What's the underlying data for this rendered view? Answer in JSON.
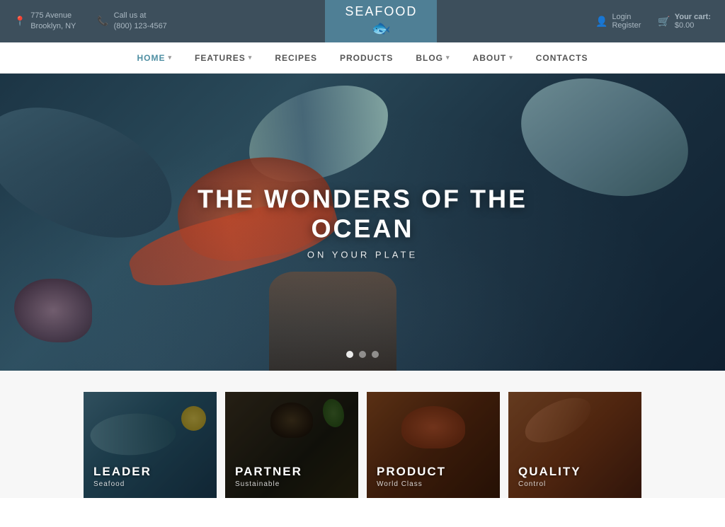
{
  "topbar": {
    "address_icon": "📍",
    "address_line1": "775 Avenue",
    "address_line2": "Brooklyn, NY",
    "phone_icon": "📞",
    "phone_label": "Call us at",
    "phone_number": "(800) 123-4567",
    "logo_part1": "SEA",
    "logo_part2": "FOOD",
    "login_icon": "👤",
    "login_label": "Login",
    "register_label": "Register",
    "cart_icon": "🛒",
    "cart_label": "Your cart:",
    "cart_amount": "$0.00"
  },
  "nav": {
    "items": [
      {
        "label": "HOME",
        "active": true,
        "has_arrow": true
      },
      {
        "label": "FEATURES",
        "active": false,
        "has_arrow": true
      },
      {
        "label": "RECIPES",
        "active": false,
        "has_arrow": false
      },
      {
        "label": "PRODUCTS",
        "active": false,
        "has_arrow": false
      },
      {
        "label": "BLOG",
        "active": false,
        "has_arrow": true
      },
      {
        "label": "ABOUT",
        "active": false,
        "has_arrow": true
      },
      {
        "label": "CONTACTS",
        "active": false,
        "has_arrow": false
      }
    ]
  },
  "hero": {
    "title": "THE WONDERS OF THE OCEAN",
    "subtitle": "ON YOUR PLATE",
    "dots": [
      {
        "active": true
      },
      {
        "active": false
      },
      {
        "active": false
      }
    ]
  },
  "cards": [
    {
      "id": "leader",
      "title": "LEADER",
      "subtitle": "Seafood"
    },
    {
      "id": "partner",
      "title": "PARTNER",
      "subtitle": "Sustainable"
    },
    {
      "id": "product",
      "title": "PRODUCT",
      "subtitle": "World Class"
    },
    {
      "id": "quality",
      "title": "QUALITY",
      "subtitle": "Control"
    }
  ]
}
